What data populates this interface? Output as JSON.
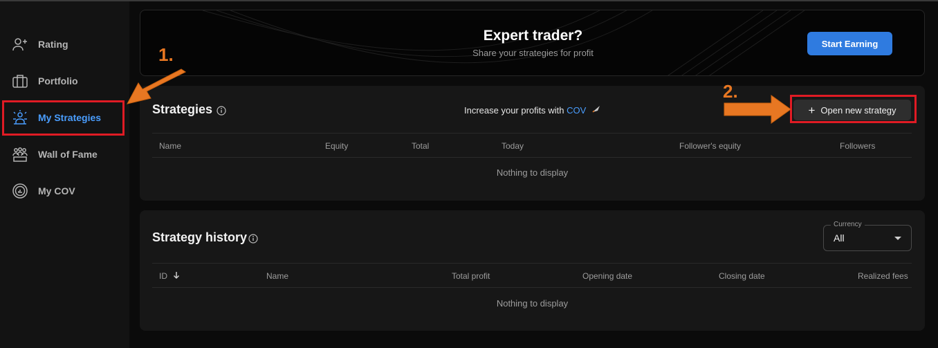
{
  "sidebar": {
    "items": [
      {
        "label": "Rating",
        "icon": "user-plus-icon"
      },
      {
        "label": "Portfolio",
        "icon": "briefcase-icon"
      },
      {
        "label": "My Strategies",
        "icon": "strategies-icon",
        "active": true
      },
      {
        "label": "Wall of Fame",
        "icon": "group-icon"
      },
      {
        "label": "My COV",
        "icon": "cov-icon"
      }
    ]
  },
  "banner": {
    "title": "Expert trader?",
    "subtitle": "Share your strategies for profit",
    "button": "Start Earning"
  },
  "strategies": {
    "title": "Strategies",
    "promo_text": "Increase your profits with ",
    "promo_link": "COV",
    "open_button": "Open new strategy",
    "columns": [
      "Name",
      "Equity",
      "Total",
      "Today",
      "Follower's equity",
      "Followers"
    ],
    "empty_text": "Nothing to display"
  },
  "history": {
    "title": "Strategy history",
    "currency_label": "Currency",
    "currency_value": "All",
    "columns": [
      "ID",
      "Name",
      "Total profit",
      "Opening date",
      "Closing date",
      "Realized fees"
    ],
    "empty_text": "Nothing to display"
  },
  "annotations": {
    "step1": "1.",
    "step2": "2."
  },
  "colors": {
    "accent": "#4a9eff",
    "primary_button": "#2f7be0",
    "highlight": "#e01b24",
    "annotation": "#e87722"
  }
}
